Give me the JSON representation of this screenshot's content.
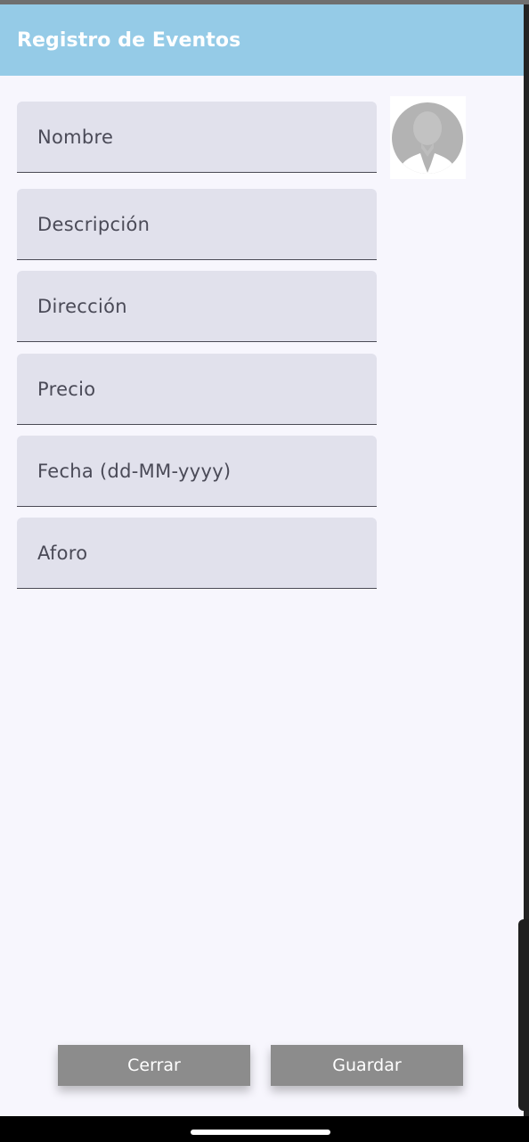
{
  "app_bar": {
    "title": "Registro de Eventos"
  },
  "form": {
    "fields": [
      {
        "placeholder": "Nombre"
      },
      {
        "placeholder": "Descripción"
      },
      {
        "placeholder": "Dirección"
      },
      {
        "placeholder": "Precio"
      },
      {
        "placeholder": "Fecha (dd-MM-yyyy)"
      },
      {
        "placeholder": "Aforo"
      }
    ],
    "avatar_icon": "person-silhouette-icon"
  },
  "buttons": {
    "close_label": "Cerrar",
    "save_label": "Guardar"
  },
  "colors": {
    "app_bar": "#95cbe7",
    "field_bg": "#e1e1ec",
    "button_bg": "#8c8c8c",
    "page_bg": "#f7f6fd"
  }
}
